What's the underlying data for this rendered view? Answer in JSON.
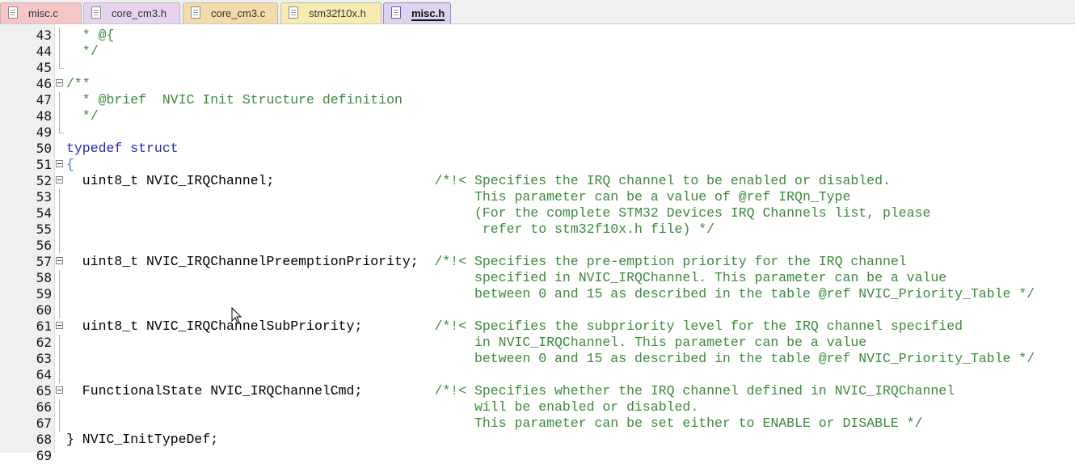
{
  "tabs": [
    {
      "label": "misc.c",
      "color": "#f7c7c7"
    },
    {
      "label": "core_cm3.h",
      "color": "#e7d3ee"
    },
    {
      "label": "core_cm3.c",
      "color": "#f3dca9"
    },
    {
      "label": "stm32f10x.h",
      "color": "#f7ebb0"
    },
    {
      "label": "misc.h",
      "color": "#ddd3f0",
      "active": true
    }
  ],
  "lines": [
    {
      "n": "43",
      "fold": "line",
      "text": "  * @{"
    },
    {
      "n": "44",
      "fold": "line",
      "text": "  */"
    },
    {
      "n": "45",
      "fold": "tick",
      "text": ""
    },
    {
      "n": "46",
      "fold": "box",
      "text": "/**"
    },
    {
      "n": "47",
      "fold": "line",
      "text": "  * @brief  NVIC Init Structure definition"
    },
    {
      "n": "48",
      "fold": "line",
      "text": "  */"
    },
    {
      "n": "49",
      "fold": "tick",
      "text": ""
    },
    {
      "n": "50",
      "fold": "",
      "text": "typedef struct"
    },
    {
      "n": "51",
      "fold": "box",
      "text": "{"
    },
    {
      "n": "52",
      "fold": "box",
      "text": "  uint8_t NVIC_IRQChannel;                    /*!< Specifies the IRQ channel to be enabled or disabled."
    },
    {
      "n": "53",
      "fold": "line",
      "text": "                                                   This parameter can be a value of @ref IRQn_Type"
    },
    {
      "n": "54",
      "fold": "line",
      "text": "                                                   (For the complete STM32 Devices IRQ Channels list, please"
    },
    {
      "n": "55",
      "fold": "line",
      "text": "                                                    refer to stm32f10x.h file) */"
    },
    {
      "n": "56",
      "fold": "line",
      "text": ""
    },
    {
      "n": "57",
      "fold": "box",
      "text": "  uint8_t NVIC_IRQChannelPreemptionPriority;  /*!< Specifies the pre-emption priority for the IRQ channel"
    },
    {
      "n": "58",
      "fold": "line",
      "text": "                                                   specified in NVIC_IRQChannel. This parameter can be a value"
    },
    {
      "n": "59",
      "fold": "line",
      "text": "                                                   between 0 and 15 as described in the table @ref NVIC_Priority_Table */"
    },
    {
      "n": "60",
      "fold": "line",
      "text": ""
    },
    {
      "n": "61",
      "fold": "box",
      "text": "  uint8_t NVIC_IRQChannelSubPriority;         /*!< Specifies the subpriority level for the IRQ channel specified"
    },
    {
      "n": "62",
      "fold": "line",
      "text": "                                                   in NVIC_IRQChannel. This parameter can be a value"
    },
    {
      "n": "63",
      "fold": "line",
      "text": "                                                   between 0 and 15 as described in the table @ref NVIC_Priority_Table */"
    },
    {
      "n": "64",
      "fold": "line",
      "text": ""
    },
    {
      "n": "65",
      "fold": "box",
      "text": "  FunctionalState NVIC_IRQChannelCmd;         /*!< Specifies whether the IRQ channel defined in NVIC_IRQChannel"
    },
    {
      "n": "66",
      "fold": "line",
      "text": "                                                   will be enabled or disabled."
    },
    {
      "n": "67",
      "fold": "line",
      "text": "                                                   This parameter can be set either to ENABLE or DISABLE */"
    },
    {
      "n": "68",
      "fold": "",
      "text": "} NVIC_InitTypeDef;"
    },
    {
      "n": "69",
      "fold": "",
      "text": ""
    }
  ]
}
